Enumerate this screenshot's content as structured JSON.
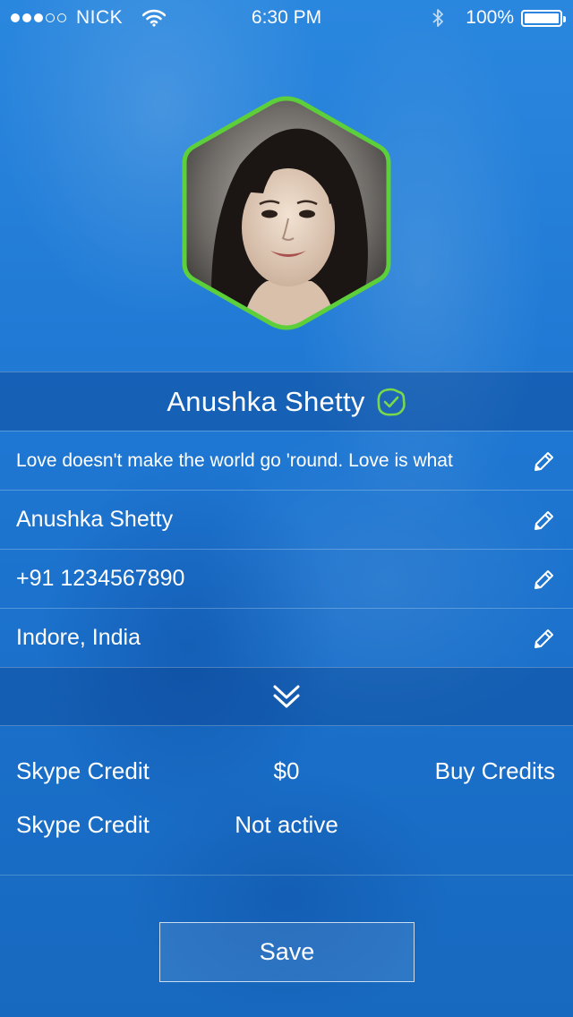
{
  "status_bar": {
    "signal_dots_filled": 3,
    "signal_dots_total": 5,
    "carrier": "NICK",
    "time": "6:30 PM",
    "battery_percent": "100%",
    "icons": [
      "wifi-icon",
      "bluetooth-icon",
      "battery-icon"
    ]
  },
  "profile": {
    "avatar": "profile-photo",
    "avatar_border_color": "#5ccf3a",
    "name": "Anushka Shetty",
    "verified_color": "#79d94a"
  },
  "fields": {
    "mood": "Love doesn't make the world go 'round. Love is what",
    "full_name": "Anushka Shetty",
    "phone": "+91 1234567890",
    "location": "Indore, India"
  },
  "credits": [
    {
      "label": "Skype Credit",
      "value": "$0",
      "action": "Buy Credits"
    },
    {
      "label": "Skype Credit",
      "value": "Not active"
    }
  ],
  "save_label": "Save",
  "colors": {
    "background": "#1f79d4",
    "text": "#ffffff"
  }
}
